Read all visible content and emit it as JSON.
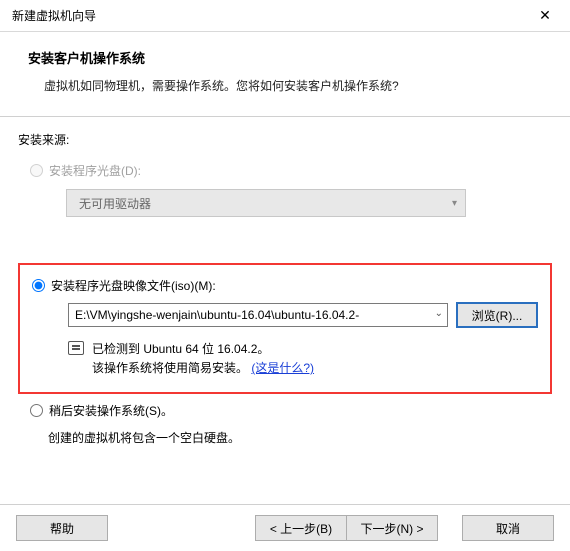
{
  "window": {
    "title": "新建虚拟机向导",
    "close": "✕"
  },
  "header": {
    "heading": "安装客户机操作系统",
    "subtext": "虚拟机如同物理机，需要操作系统。您将如何安装客户机操作系统?"
  },
  "source": {
    "label": "安装来源:",
    "disc": {
      "label": "安装程序光盘(D):",
      "dropdown": "无可用驱动器"
    },
    "iso": {
      "label": "安装程序光盘映像文件(iso)(M):",
      "path": "E:\\VM\\yingshe-wenjain\\ubuntu-16.04\\ubuntu-16.04.2-",
      "browse": "浏览(R)...",
      "detected_line1": "已检测到 Ubuntu 64 位 16.04.2。",
      "detected_line2_prefix": "该操作系统将使用简易安装。",
      "detected_link": "(这是什么?)"
    },
    "later": {
      "label": "稍后安装操作系统(S)。",
      "note": "创建的虚拟机将包含一个空白硬盘。"
    }
  },
  "footer": {
    "help": "帮助",
    "back": "< 上一步(B)",
    "next": "下一步(N) >",
    "cancel": "取消"
  }
}
